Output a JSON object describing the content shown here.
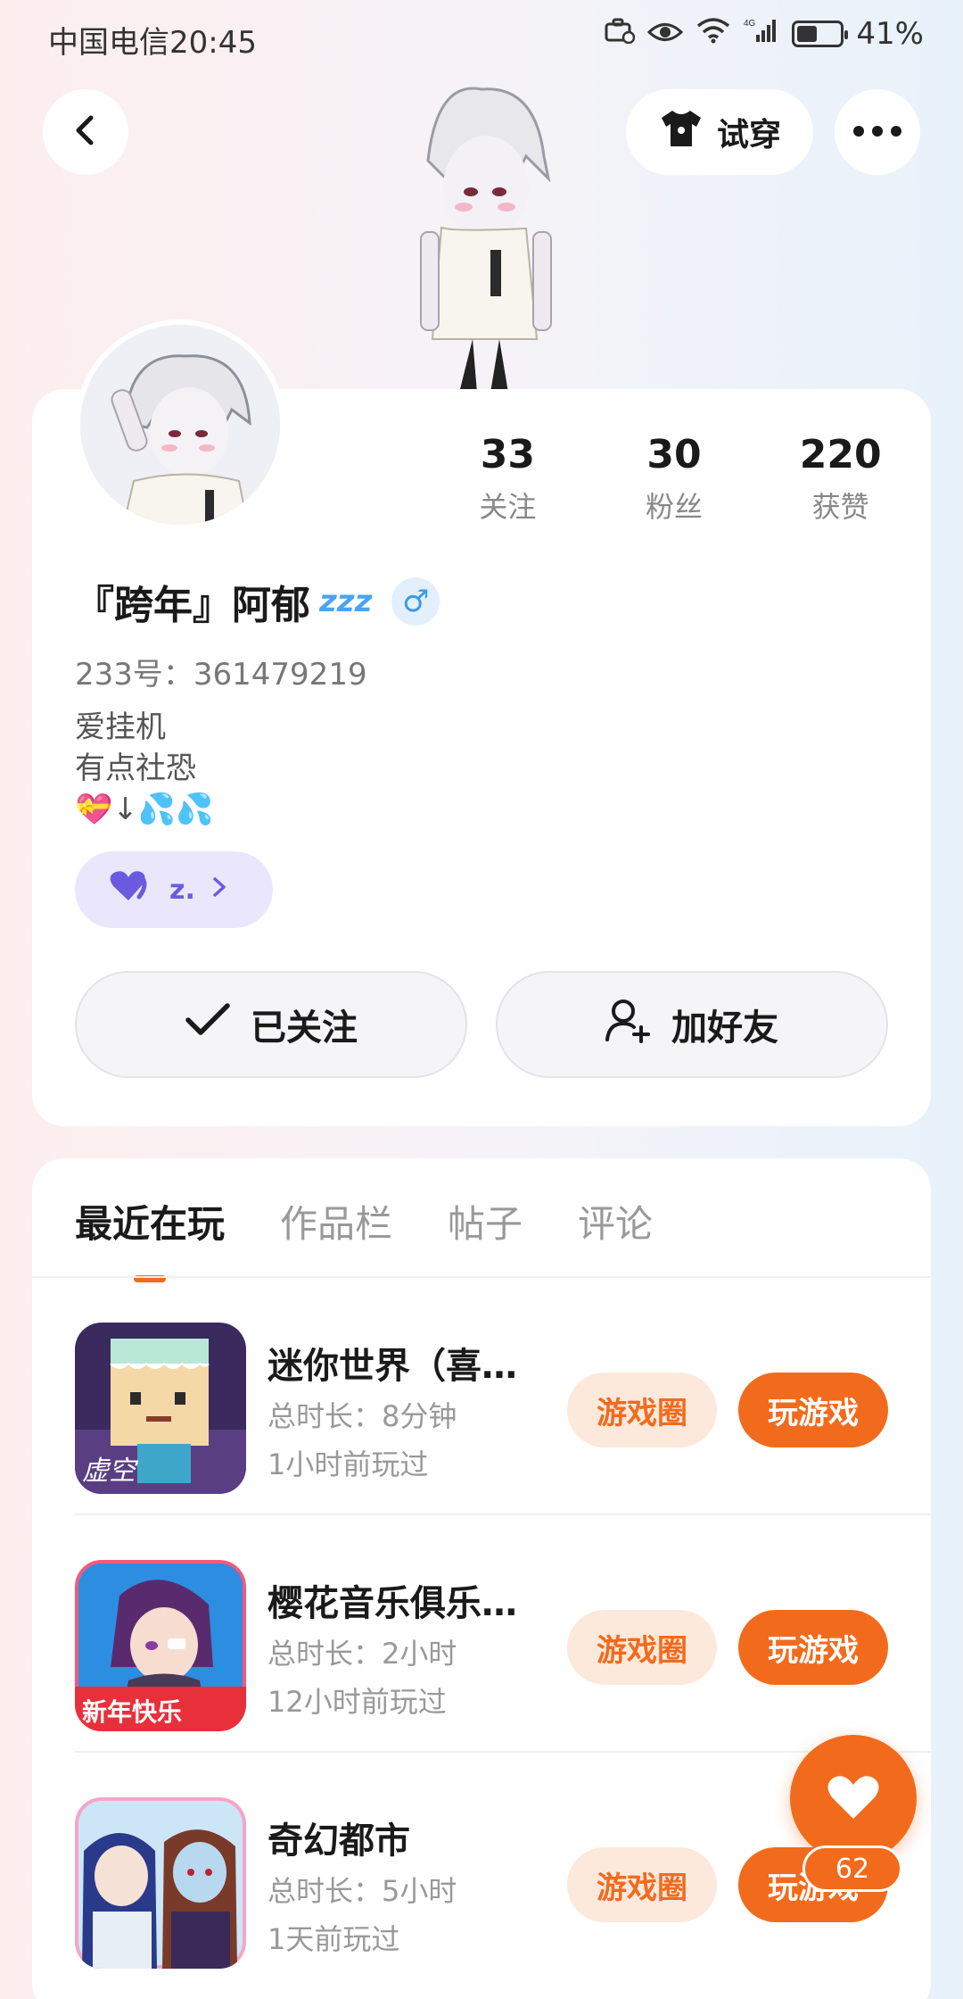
{
  "status_bar": {
    "carrier_time": "中国电信20:45",
    "network": "4G",
    "battery_percent": "41%",
    "battery_level": 0.41
  },
  "header": {
    "tryon_label": "试穿"
  },
  "profile": {
    "stats": [
      {
        "value": "33",
        "label": "关注"
      },
      {
        "value": "30",
        "label": "粉丝"
      },
      {
        "value": "220",
        "label": "获赞"
      }
    ],
    "name": "『跨年』阿郁",
    "zzz": "zzz",
    "gender_symbol": "♂",
    "uid": "233号：361479219",
    "bio_lines": [
      "爱挂机",
      "有点社恐"
    ],
    "bio_emoji": "💝↓💦💦",
    "tag_label": "z.",
    "follow_label": "已关注",
    "add_friend_label": "加好友"
  },
  "tabs": [
    "最近在玩",
    "作品栏",
    "帖子",
    "评论"
  ],
  "games": [
    {
      "title": "迷你世界（喜…",
      "duration": "总时长：8分钟",
      "last_played": "1小时前玩过",
      "circle_label": "游戏圈",
      "play_label": "玩游戏"
    },
    {
      "title": "樱花音乐俱乐…",
      "duration": "总时长：2小时",
      "last_played": "12小时前玩过",
      "circle_label": "游戏圈",
      "play_label": "玩游戏"
    },
    {
      "title": "奇幻都市",
      "duration": "总时长：5小时",
      "last_played": "1天前玩过",
      "circle_label": "游戏圈",
      "play_label": "玩游戏"
    }
  ],
  "like_count": "62",
  "colors": {
    "accent": "#f26b1d",
    "accent_light": "#fde9dc",
    "tag_bg": "#eae7fc",
    "tag_fg": "#6b5ae0"
  }
}
